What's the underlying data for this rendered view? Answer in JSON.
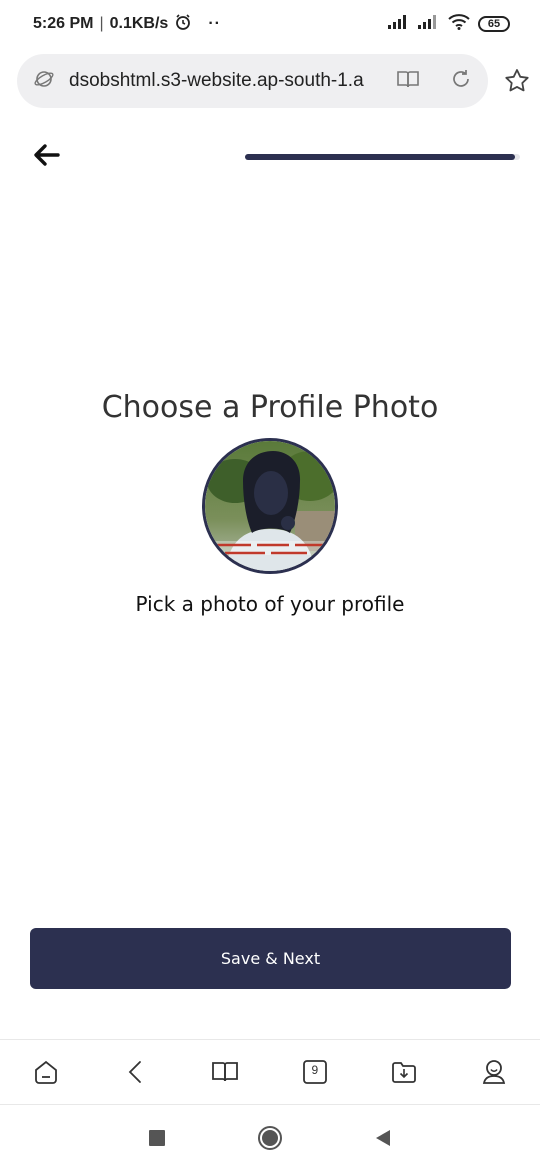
{
  "status_bar": {
    "time": "5:26 PM",
    "separator": "|",
    "speed": "0.1KB/s",
    "battery": "65"
  },
  "browser": {
    "url": "dsobshtml.s3-website.ap-south-1.a"
  },
  "progress": {
    "value": 0.98
  },
  "main": {
    "title": "Choose a Profile Photo",
    "subtitle": "Pick a photo of your profile",
    "save_label": "Save & Next"
  },
  "bottom_nav": {
    "tabs_count": "9"
  },
  "colors": {
    "accent": "#2c3050",
    "url_bar_bg": "#efeff1"
  }
}
